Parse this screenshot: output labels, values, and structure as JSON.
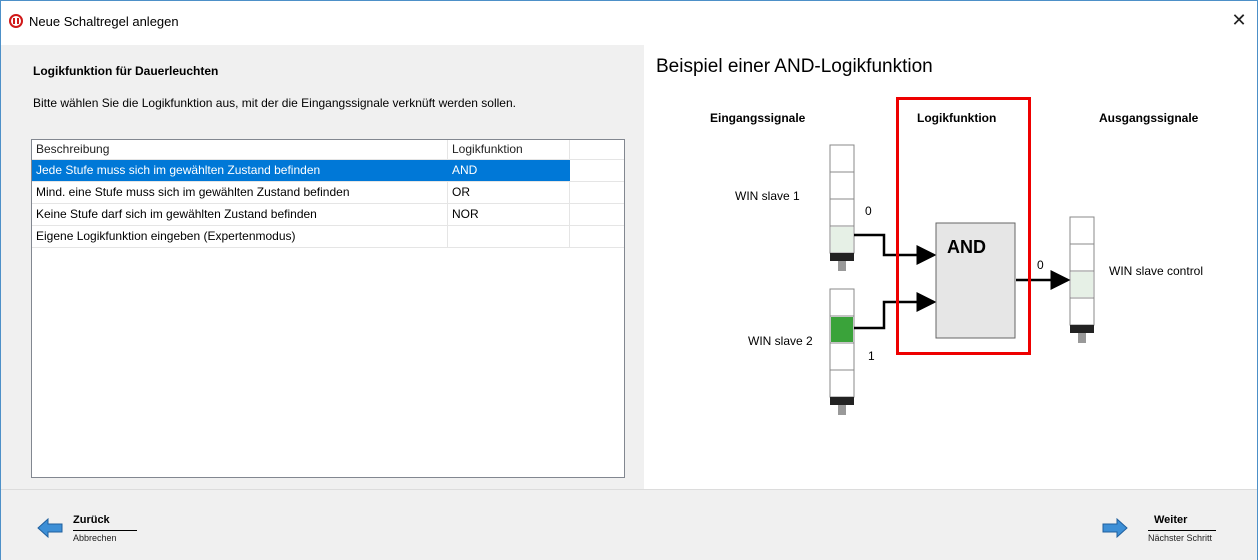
{
  "window": {
    "title": "Neue Schaltregel anlegen",
    "close_glyph": "✕"
  },
  "left": {
    "section_title": "Logikfunktion für Dauerleuchten",
    "description": "Bitte wählen Sie die Logikfunktion aus, mit der die Eingangssignale verknüft werden sollen.",
    "table": {
      "headers": [
        "Beschreibung",
        "Logikfunktion",
        ""
      ],
      "rows": [
        {
          "description": "Jede Stufe muss sich im gewählten Zustand befinden",
          "logic": "AND",
          "selected": true
        },
        {
          "description": "Mind. eine Stufe muss sich im gewählten Zustand befinden",
          "logic": "OR",
          "selected": false
        },
        {
          "description": "Keine Stufe darf sich im gewählten Zustand befinden",
          "logic": "NOR",
          "selected": false
        },
        {
          "description": "Eigene Logikfunktion eingeben (Expertenmodus)",
          "logic": "",
          "selected": false
        }
      ]
    }
  },
  "right": {
    "title": "Beispiel einer AND-Logikfunktion",
    "inputs_heading": "Eingangssignale",
    "logic_heading": "Logikfunktion",
    "outputs_heading": "Ausgangssignale",
    "slave1_label": "WIN slave 1",
    "slave1_value": "0",
    "slave2_label": "WIN slave 2",
    "slave2_value": "1",
    "gate_label": "AND",
    "output_value": "0",
    "output_label": "WIN slave control",
    "colors": {
      "highlight": "#ee0000",
      "lamp_on": "#3aa33a",
      "lamp_pale": "#e6f0e6",
      "gate_fill": "#e6e6e6"
    }
  },
  "footer": {
    "back_label": "Zurück",
    "back_sub": "Abbrechen",
    "next_label": "Weiter",
    "next_sub": "Nächster Schritt",
    "icons": {
      "back": "arrow-left-icon",
      "next": "arrow-right-icon"
    }
  }
}
